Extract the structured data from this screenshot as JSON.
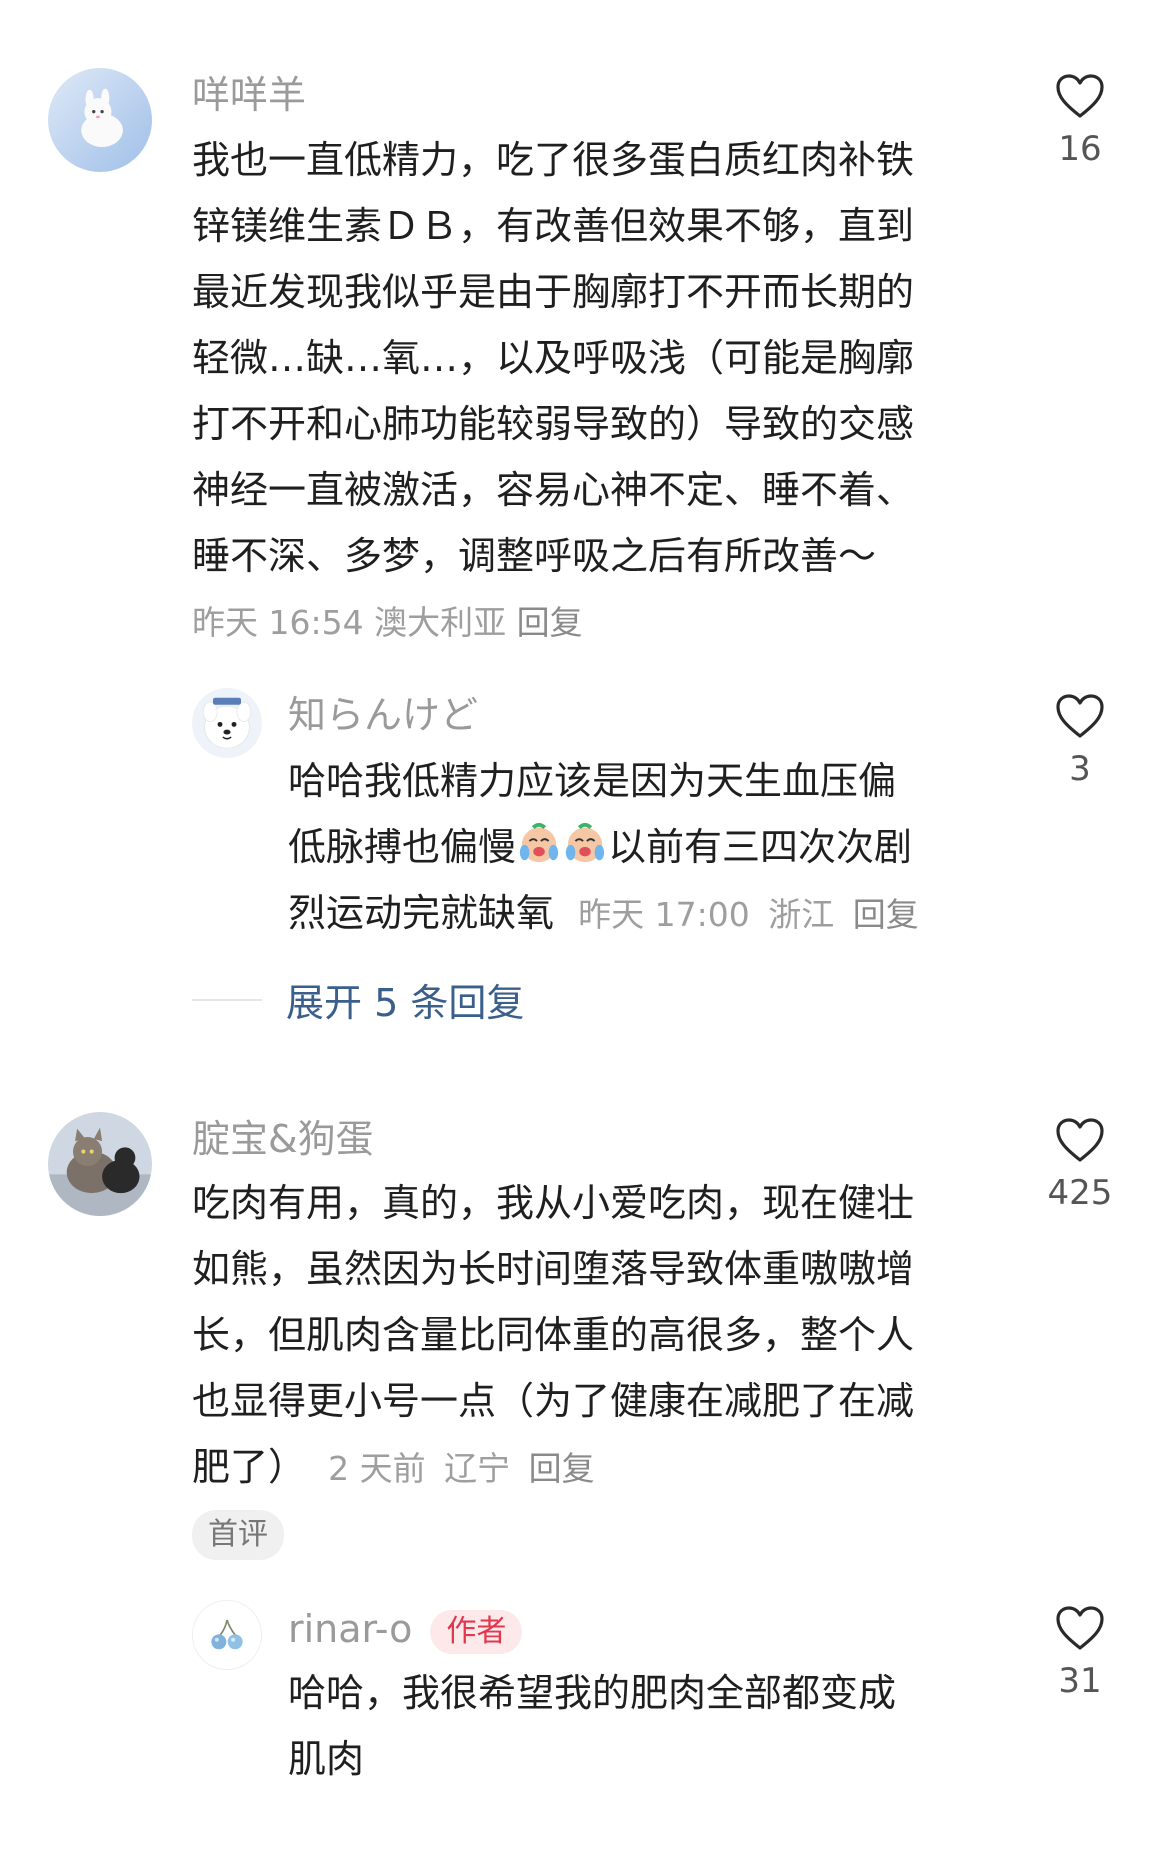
{
  "comments": [
    {
      "username": "咩咩羊",
      "lines": [
        "我也一直低精力，吃了很多蛋白质红肉补铁",
        "锌镁维生素ＤＢ，有改善但效果不够，直到",
        "最近发现我似乎是由于胸廓打不开而长期的",
        "轻微…缺…氧…，以及呼吸浅（可能是胸廓",
        "打不开和心肺功能较弱导致的）导致的交感",
        "神经一直被激活，容易心神不定、睡不着、",
        "睡不深、多梦，调整呼吸之后有所改善～"
      ],
      "time": "昨天 16:54",
      "location": "澳大利亚",
      "reply": "回复",
      "likes": "16",
      "avatar_icon": "bunny-avatar-icon",
      "replies": [
        {
          "username": "知らんけど",
          "line1": "哈哈我低精力应该是因为天生血压偏",
          "line2_pre": "低脉搏也偏慢",
          "line2_post": "以前有三四次次剧",
          "line3": "烈运动完就缺氧",
          "time": "昨天 17:00",
          "location": "浙江",
          "reply": "回复",
          "likes": "3",
          "avatar_icon": "samoyed-dog-avatar-icon",
          "emoji_icon": "crying-face-emoji-icon"
        }
      ],
      "expand_label": "展开 5 条回复"
    },
    {
      "username": "腚宝&狗蛋",
      "lines": [
        "吃肉有用，真的，我从小爱吃肉，现在健壮",
        "如熊，虽然因为长时间堕落导致体重嗷嗷增",
        "长，但肌肉含量比同体重的高很多，整个人",
        "也显得更小号一点（为了健康在减肥了在减"
      ],
      "last_line": "肥了）",
      "time": "2 天前",
      "location": "辽宁",
      "reply": "回复",
      "likes": "425",
      "badge": "首评",
      "avatar_icon": "cats-avatar-icon",
      "replies": [
        {
          "username": "rinar-o",
          "author_badge": "作者",
          "lines": [
            "哈哈，我很希望我的肥肉全部都变成",
            "肌肉"
          ],
          "likes": "31",
          "avatar_icon": "blue-fruit-avatar-icon"
        }
      ]
    }
  ],
  "colors": {
    "accent_link": "#3a5f8a",
    "author_badge": "#e0394e",
    "meta": "#9e9e9e"
  }
}
